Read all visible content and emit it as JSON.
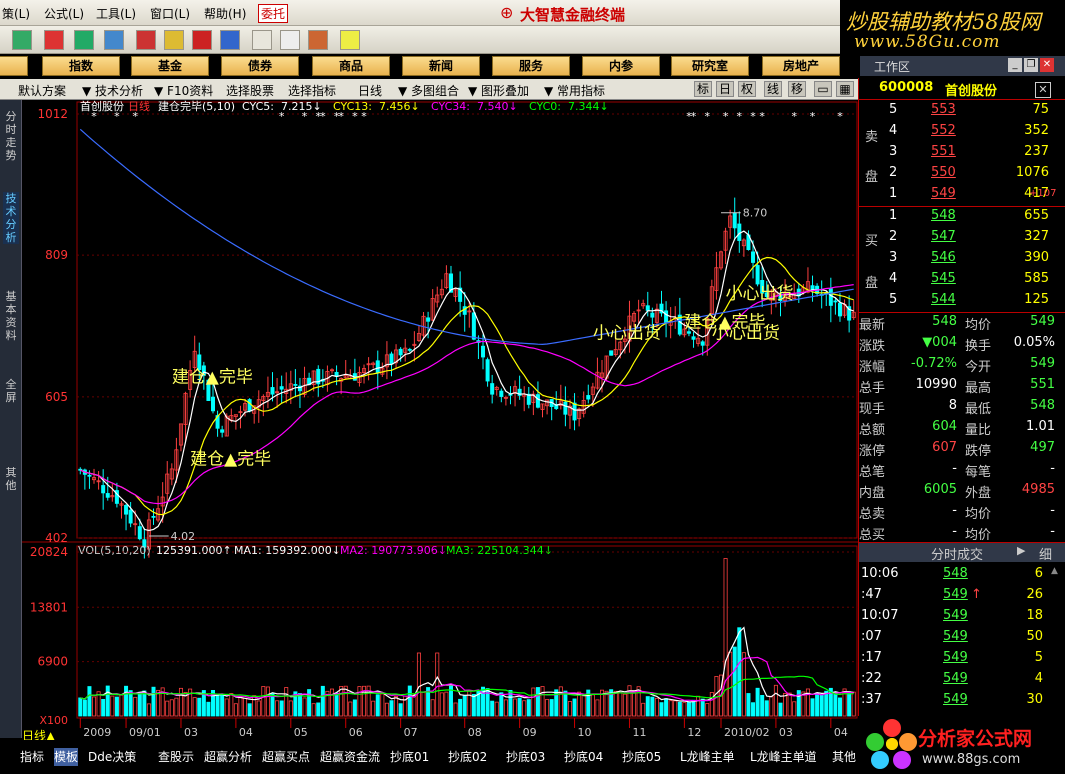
{
  "menu": {
    "items": [
      "策(L)",
      "公式(L)",
      "工具(L)",
      "窗口(L)",
      "帮助(H)",
      "委托"
    ],
    "app_title": "大智慧金融终端"
  },
  "watermark": {
    "top_line1": "炒股辅助教材58股网",
    "top_line2": "www.58Gu.com",
    "bottom_site": "分析家公式网",
    "bottom_url": "www.88gs.com"
  },
  "navbar": {
    "items": [
      "",
      "指数",
      "基金",
      "债券",
      "商品",
      "新闻",
      "服务",
      "内参",
      "研究室",
      "房地产"
    ]
  },
  "workspace": {
    "label": "工作区"
  },
  "subbar": {
    "items": [
      "默认方案",
      "技术分析",
      "F10资料",
      "选择股票",
      "选择指标",
      "日线",
      "多图组合",
      "图形叠加",
      "常用指标"
    ],
    "mode_buttons": [
      "标",
      "日",
      "权",
      "线",
      "移"
    ]
  },
  "left_tabs": [
    "分时走势",
    "技术分析",
    "基本资料",
    "全屏",
    "其他"
  ],
  "chart_data": {
    "type": "candlestick",
    "stock": "首创股份",
    "period": "日线",
    "indicator_name": "建仓完毕(5,10)",
    "legend": [
      {
        "label": "CYC5:",
        "value": "7.215↓",
        "color": "#ffffff"
      },
      {
        "label": "CYC13:",
        "value": "7.456↓",
        "color": "#ffff00"
      },
      {
        "label": "CYC34:",
        "value": "7.540↓",
        "color": "#ff00ff"
      },
      {
        "label": "CYC0:",
        "value": "7.344↓",
        "color": "#00ff00"
      }
    ],
    "price_ticks": [
      {
        "v": 10.12,
        "label": "1012"
      },
      {
        "v": 8.09,
        "label": "809"
      },
      {
        "v": 6.05,
        "label": "605"
      },
      {
        "v": 4.02,
        "label": "402"
      }
    ],
    "ylim": [
      4.02,
      10.12
    ],
    "max_label": "8.70",
    "min_label": "4.02",
    "annotations": [
      {
        "text": "建仓▲完毕",
        "x": 20,
        "y": 6.26
      },
      {
        "text": "建仓▲完毕",
        "x": 24,
        "y": 5.08
      },
      {
        "text": "小心出货",
        "x": 112,
        "y": 6.89
      },
      {
        "text": "建仓▲完毕",
        "x": 132,
        "y": 7.05
      },
      {
        "text": "小心出货",
        "x": 138,
        "y": 6.89
      },
      {
        "text": "小心出货",
        "x": 141,
        "y": 7.46
      }
    ],
    "volume": {
      "title": "VOL(5,10,20)",
      "value": "125391.000↑",
      "ma1": "MA1: 159392.000↓",
      "ma2": "MA2: 190773.906↓",
      "ma3": "MA3: 225104.344↓",
      "ticks": [
        "20824",
        "13801",
        "6900",
        "X100"
      ],
      "ymax": 20824
    },
    "x_labels": [
      "2009",
      "09/01",
      "03",
      "04",
      "05",
      "06",
      "07",
      "08",
      "09",
      "10",
      "11",
      "12",
      "2010/02",
      "03",
      "04"
    ],
    "n": 170
  },
  "quote": {
    "code": "600008",
    "name": "首创股份",
    "sell_label": [
      "卖",
      "盘"
    ],
    "buy_label": [
      "买",
      "盘"
    ],
    "sells": [
      {
        "lv": "5",
        "p": "553",
        "v": "75"
      },
      {
        "lv": "4",
        "p": "552",
        "v": "352"
      },
      {
        "lv": "3",
        "p": "551",
        "v": "237"
      },
      {
        "lv": "2",
        "p": "550",
        "v": "1076"
      },
      {
        "lv": "1",
        "p": "549",
        "v": "417",
        "ex": "+107"
      }
    ],
    "buys": [
      {
        "lv": "1",
        "p": "548",
        "v": "655"
      },
      {
        "lv": "2",
        "p": "547",
        "v": "327"
      },
      {
        "lv": "3",
        "p": "546",
        "v": "390"
      },
      {
        "lv": "4",
        "p": "545",
        "v": "585"
      },
      {
        "lv": "5",
        "p": "544",
        "v": "125"
      }
    ],
    "stats": [
      {
        "k1": "最新",
        "v1": "548",
        "k2": "均价",
        "v2": "549"
      },
      {
        "k1": "涨跌",
        "v1": "▼004",
        "k2": "换手",
        "v2": "0.05%"
      },
      {
        "k1": "涨幅",
        "v1": "-0.72%",
        "k2": "今开",
        "v2": "549"
      },
      {
        "k1": "总手",
        "v1": "10990",
        "k2": "最高",
        "v2": "551"
      },
      {
        "k1": "现手",
        "v1": "8",
        "k2": "最低",
        "v2": "548"
      },
      {
        "k1": "总额",
        "v1": "604",
        "k2": "量比",
        "v2": "1.01"
      },
      {
        "k1": "涨停",
        "v1": "607",
        "k2": "跌停",
        "v2": "497"
      },
      {
        "k1": "总笔",
        "v1": "-",
        "k2": "每笔",
        "v2": "-"
      },
      {
        "k1": "内盘",
        "v1": "6005",
        "k2": "外盘",
        "v2": "4985"
      },
      {
        "k1": "总卖",
        "v1": "-",
        "k2": "均价",
        "v2": "-"
      },
      {
        "k1": "总买",
        "v1": "-",
        "k2": "均价",
        "v2": "-"
      }
    ],
    "tick_header": "分时成交",
    "tick_more": "细",
    "ticks": [
      {
        "t": "10:06",
        "p": "548",
        "v": "6"
      },
      {
        "t": ":47",
        "p": "549",
        "v": "26"
      },
      {
        "t": "10:07",
        "p": "549",
        "v": "18"
      },
      {
        "t": ":07",
        "p": "549",
        "v": "50"
      },
      {
        "t": ":17",
        "p": "549",
        "v": "5"
      },
      {
        "t": ":22",
        "p": "549",
        "v": "4"
      },
      {
        "t": ":37",
        "p": "549",
        "v": "30"
      }
    ]
  },
  "bottom_tabs": [
    "指标",
    "模板",
    "Dde决策",
    "查股示",
    "超赢分析",
    "超赢买点",
    "超赢资金流",
    "抄底01",
    "抄底02",
    "抄底03",
    "抄底04",
    "抄底05",
    "L龙峰主单",
    "L龙峰主单道",
    "其他"
  ],
  "period_label": "日线▲",
  "colors": {
    "up": "#ff4040",
    "down": "#00ffff",
    "ma5": "#ffffff",
    "ma13": "#ffff00",
    "ma34": "#ff00ff",
    "ma0": "#00c000",
    "long": "#3a6cff"
  }
}
